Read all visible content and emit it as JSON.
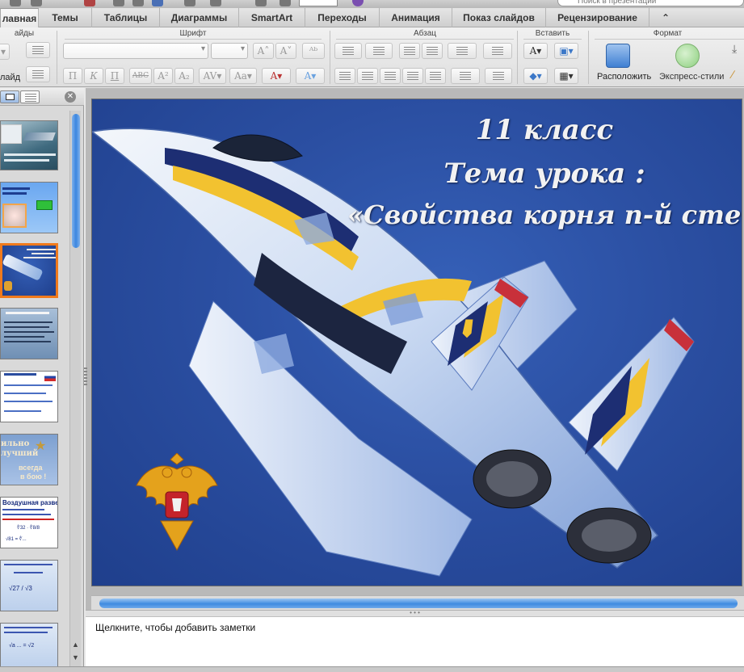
{
  "ribbon_tabs": [
    "лавная",
    "Темы",
    "Таблицы",
    "Диаграммы",
    "SmartArt",
    "Переходы",
    "Анимация",
    "Показ слайдов",
    "Рецензирование"
  ],
  "active_tab": "лавная",
  "search_placeholder": "Поиск в презентации",
  "ribbon_groups": {
    "slides": {
      "title": "айды",
      "new_slide_label": "лайд"
    },
    "font": {
      "title": "Шрифт"
    },
    "paragraph": {
      "title": "Абзац"
    },
    "insert": {
      "title": "Вставить"
    },
    "format": {
      "title": "Формат",
      "arrange_label": "Расположить",
      "quick_styles_label": "Экспресс-стили"
    }
  },
  "font_buttons": [
    "П",
    "К",
    "П",
    "ABC",
    "A²",
    "A₂"
  ],
  "slide": {
    "title_line1": "11 класс",
    "title_line2": "Тема урока :",
    "title_line3": "«Свойства корня n-й степени»"
  },
  "notes_placeholder": "Щелкните, чтобы добавить заметки",
  "thumbnails": [
    {
      "id": 1,
      "selected": false
    },
    {
      "id": 2,
      "selected": false
    },
    {
      "id": 3,
      "selected": true
    },
    {
      "id": 4,
      "selected": false
    },
    {
      "id": 5,
      "selected": false
    },
    {
      "id": 6,
      "selected": false
    },
    {
      "id": 7,
      "selected": false
    },
    {
      "id": 8,
      "selected": false
    },
    {
      "id": 9,
      "selected": false
    }
  ],
  "thumb_texts": {
    "t6_line1": "ильно",
    "t6_line2": "лучший",
    "t6_line3": "ВВС",
    "t6_line4": "всегда",
    "t6_line5": "в бою !",
    "t7_title": "Воздушная разведка",
    "t7_formula1": "∜32 · ∜8/8",
    "t7_formula2": "√81 = ∜...",
    "t8_formula": "√27 / √3",
    "t9_formula": "√a ... = √2"
  },
  "colors": {
    "slide_bg": "#2b4fa2",
    "selection": "#f07a1c",
    "scroll_knob": "#3f8be0"
  }
}
